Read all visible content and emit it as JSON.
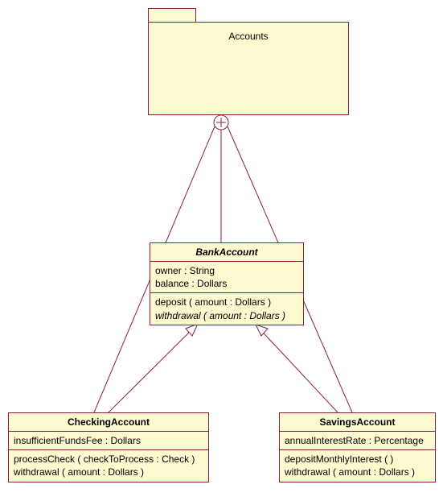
{
  "package": {
    "name": "Accounts"
  },
  "classes": {
    "bank": {
      "name": "BankAccount",
      "attrs": [
        "owner : String",
        "balance : Dollars"
      ],
      "ops": [
        {
          "text": "deposit ( amount : Dollars )",
          "italic": false
        },
        {
          "text": "withdrawal ( amount : Dollars )",
          "italic": true
        }
      ]
    },
    "checking": {
      "name": "CheckingAccount",
      "attrs": [
        "insufficientFundsFee : Dollars"
      ],
      "ops": [
        {
          "text": "processCheck ( checkToProcess : Check )",
          "italic": false
        },
        {
          "text": "withdrawal ( amount : Dollars )",
          "italic": false
        }
      ]
    },
    "savings": {
      "name": "SavingsAccount",
      "attrs": [
        "annualInterestRate : Percentage"
      ],
      "ops": [
        {
          "text": "depositMonthlyInterest (  )",
          "italic": false
        },
        {
          "text": "withdrawal ( amount : Dollars )",
          "italic": false
        }
      ]
    }
  }
}
